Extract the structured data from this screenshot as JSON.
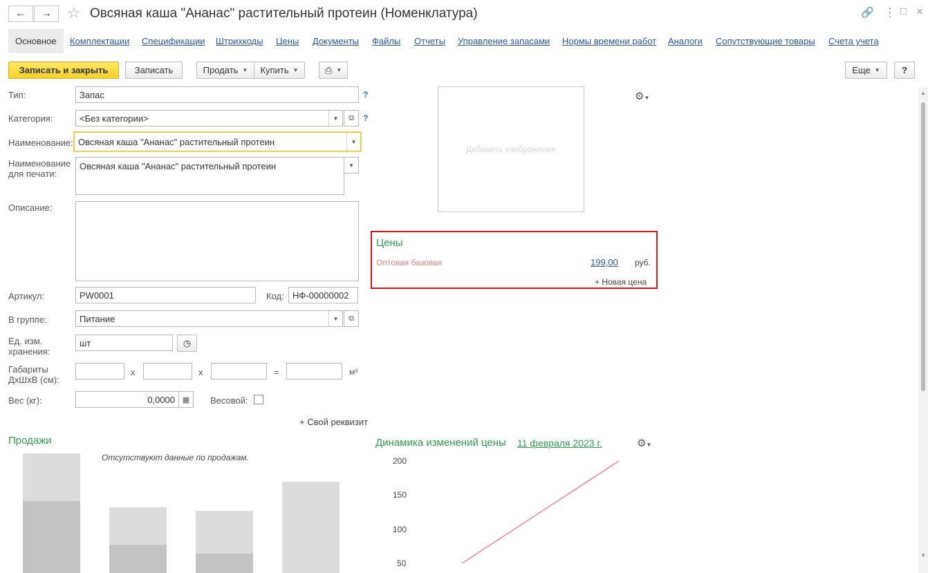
{
  "window": {
    "title": "Овсяная каша \"Ананас\" растительный протеин (Номенклатура)"
  },
  "tabs": [
    "Основное",
    "Комплектации",
    "Спецификации",
    "Штрихкоды",
    "Цены",
    "Документы",
    "Файлы",
    "Отчеты",
    "Управление запасами",
    "Нормы времени работ",
    "Аналоги",
    "Сопутствующие товары",
    "Счета учета"
  ],
  "toolbar": {
    "save_close": "Записать и закрыть",
    "save": "Записать",
    "sell": "Продать",
    "buy": "Купить",
    "more": "Еще",
    "help": "?"
  },
  "form": {
    "type_label": "Тип:",
    "type_value": "Запас",
    "category_label": "Категория:",
    "category_value": "<Без категории>",
    "name_label": "Наименование:",
    "name_value": "Овсяная каша \"Ананас\" растительный протеин",
    "print_name_label_1": "Наименование",
    "print_name_label_2": "для печати:",
    "print_name_value": "Овсяная каша \"Ананас\" растительный протеин",
    "description_label": "Описание:",
    "article_label": "Артикул:",
    "article_value": "PW0001",
    "code_label": "Код:",
    "code_value": "НФ-00000002",
    "group_label": "В группе:",
    "group_value": "Питание",
    "unit_label_1": "Ед. изм.",
    "unit_label_2": "хранения:",
    "unit_value": "шт",
    "dims_label_1": "Габариты",
    "dims_label_2": "ДхШхВ (см):",
    "x1": "x",
    "x2": "x",
    "eq": "=",
    "m3": "м³",
    "weight_label": "Вес (кг):",
    "weight_value": "0,0000",
    "weighted_label": "Весовой:",
    "custom_attr": "+ Свой реквизит",
    "q": "?"
  },
  "image": {
    "placeholder": "Добавить изображение"
  },
  "prices": {
    "title": "Цены",
    "price_type": "Оптовая базовая",
    "price_value": "199,00",
    "currency": "руб.",
    "new_price": "+ Новая цена"
  },
  "sales": {
    "title": "Продажи",
    "no_data": "Отсутствуют данные по продажам."
  },
  "dynamics": {
    "title": "Динамика изменений цены",
    "date": "11 февраля 2023 г."
  },
  "chart_data": {
    "type": "line",
    "ylabels": [
      "200",
      "150",
      "100",
      "50"
    ]
  },
  "colors": {
    "accent_yellow": "#f4d22b",
    "link_blue": "#2855a8",
    "header_green": "#2a9d4a",
    "price_red_box": "#d8141c",
    "price_type_text": "#e8807f",
    "line_red": "#ee8f94"
  }
}
